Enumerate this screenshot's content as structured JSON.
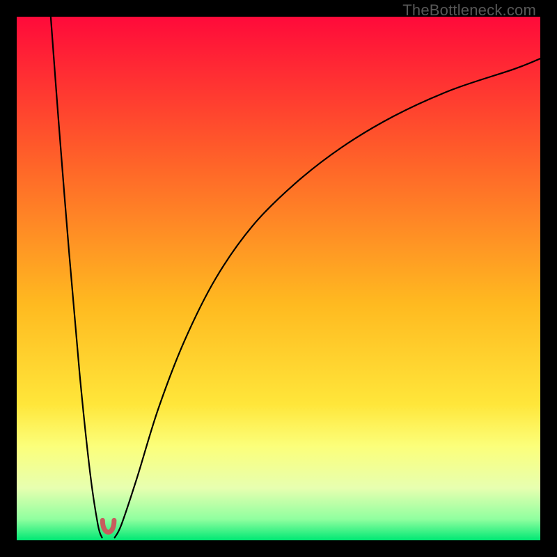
{
  "watermark": "TheBottleneck.com",
  "chart_data": {
    "type": "line",
    "title": "",
    "xlabel": "",
    "ylabel": "",
    "xlim": [
      0,
      100
    ],
    "ylim": [
      0,
      100
    ],
    "gradient_stops": [
      {
        "offset": 0,
        "color": "#ff0a3a"
      },
      {
        "offset": 25,
        "color": "#ff5a2a"
      },
      {
        "offset": 55,
        "color": "#ffba20"
      },
      {
        "offset": 74,
        "color": "#ffe63a"
      },
      {
        "offset": 82,
        "color": "#fcff7a"
      },
      {
        "offset": 90,
        "color": "#e7ffb0"
      },
      {
        "offset": 96,
        "color": "#8fff9f"
      },
      {
        "offset": 100,
        "color": "#00e874"
      }
    ],
    "series": [
      {
        "name": "left-branch",
        "x": [
          6.5,
          8,
          10,
          12,
          14,
          15.5,
          16.3
        ],
        "y": [
          100,
          80,
          55,
          32,
          13,
          3,
          0.5
        ]
      },
      {
        "name": "right-branch",
        "x": [
          18.7,
          20,
          23,
          27,
          32,
          38,
          45,
          53,
          62,
          72,
          83,
          95,
          100
        ],
        "y": [
          0.5,
          3,
          12,
          25,
          38,
          50,
          60,
          68,
          75,
          81,
          86,
          90,
          92
        ]
      }
    ],
    "vertex_marker": {
      "x_center": 17.5,
      "half_width": 1.1,
      "color": "#c75d5d",
      "stroke_width": 7
    },
    "curve_style": {
      "stroke": "#000000",
      "stroke_width": 2.2
    }
  }
}
